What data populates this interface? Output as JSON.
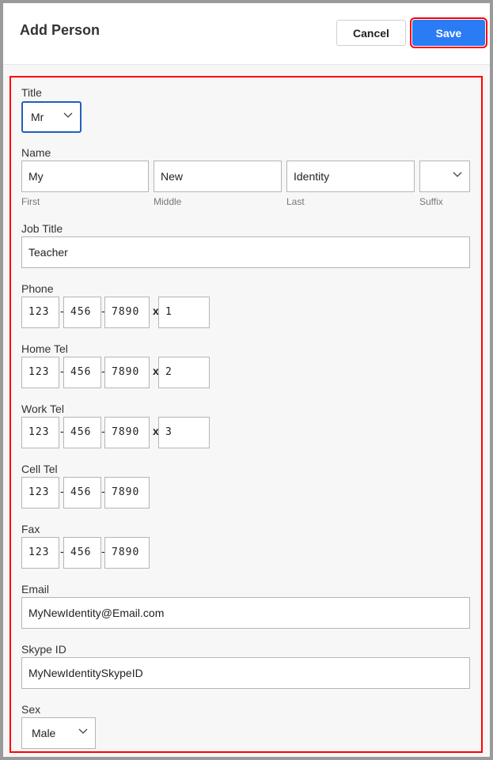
{
  "header": {
    "title": "Add Person",
    "cancel_label": "Cancel",
    "save_label": "Save"
  },
  "form": {
    "title": {
      "label": "Title",
      "value": "Mr"
    },
    "name": {
      "label": "Name",
      "first": {
        "value": "My",
        "sublabel": "First"
      },
      "middle": {
        "value": "New",
        "sublabel": "Middle"
      },
      "last": {
        "value": "Identity",
        "sublabel": "Last"
      },
      "suffix": {
        "value": "",
        "sublabel": "Suffix"
      }
    },
    "job_title": {
      "label": "Job Title",
      "value": "Teacher"
    },
    "phone": {
      "label": "Phone",
      "area": "123",
      "prefix": "456",
      "line": "7890",
      "ext": "1"
    },
    "home_tel": {
      "label": "Home Tel",
      "area": "123",
      "prefix": "456",
      "line": "7890",
      "ext": "2"
    },
    "work_tel": {
      "label": "Work Tel",
      "area": "123",
      "prefix": "456",
      "line": "7890",
      "ext": "3"
    },
    "cell_tel": {
      "label": "Cell Tel",
      "area": "123",
      "prefix": "456",
      "line": "7890"
    },
    "fax": {
      "label": "Fax",
      "area": "123",
      "prefix": "456",
      "line": "7890"
    },
    "email": {
      "label": "Email",
      "value": "MyNewIdentity@Email.com"
    },
    "skype": {
      "label": "Skype ID",
      "value": "MyNewIdentitySkypeID"
    },
    "sex": {
      "label": "Sex",
      "value": "Male"
    },
    "separators": {
      "dash": "-",
      "ext": "x"
    }
  },
  "colors": {
    "accent": "#2b7bf5",
    "highlight": "#ff0000"
  }
}
